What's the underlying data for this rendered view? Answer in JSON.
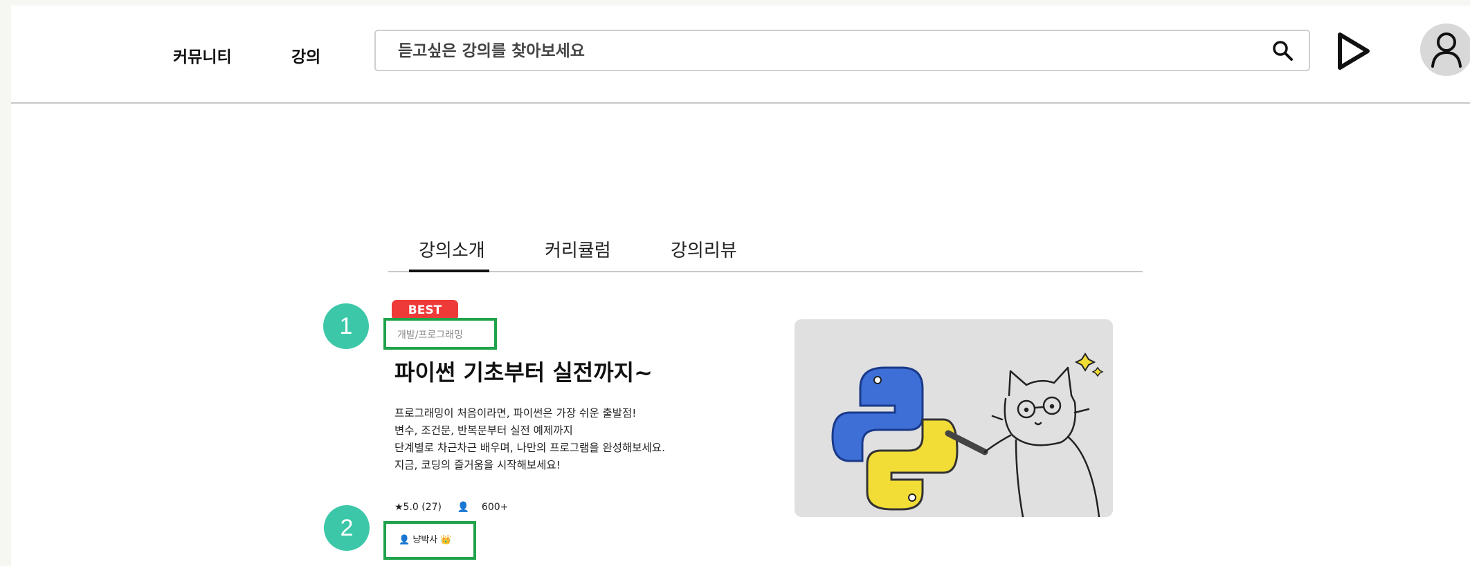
{
  "header": {
    "nav": [
      {
        "label": "커뮤니티"
      },
      {
        "label": "강의"
      }
    ],
    "search": {
      "placeholder": "듣고싶은 강의를 찾아보세요",
      "value": ""
    }
  },
  "tabs": [
    {
      "label": "강의소개",
      "active": true
    },
    {
      "label": "커리큘럼",
      "active": false
    },
    {
      "label": "강의리뷰",
      "active": false
    }
  ],
  "course": {
    "badge": "BEST",
    "category": "개발/프로그래밍",
    "title": "파이썬 기초부터 실전까지~",
    "description": [
      "프로그래밍이 처음이라면, 파이썬은 가장 쉬운 출발점!",
      "변수, 조건문, 반복문부터 실전 예제까지",
      "단계별로 차근차근 배우며, 나만의 프로그램을 완성해보세요.",
      "지금, 코딩의 즐거움을 시작해보세요!"
    ],
    "rating": "★5.0 (27)",
    "students": "600+",
    "instructor": "냥박사 👑"
  },
  "annotations": [
    {
      "number": "1"
    },
    {
      "number": "2"
    }
  ],
  "colors": {
    "badge": "#ef3a3a",
    "annotation_box": "#1fa34a",
    "annotation_circle": "#3cc8a8",
    "python_blue": "#3d6fd6",
    "python_yellow": "#f2dc36"
  },
  "icons": {
    "search": "search-icon",
    "play": "play-icon",
    "avatar": "user-icon"
  }
}
